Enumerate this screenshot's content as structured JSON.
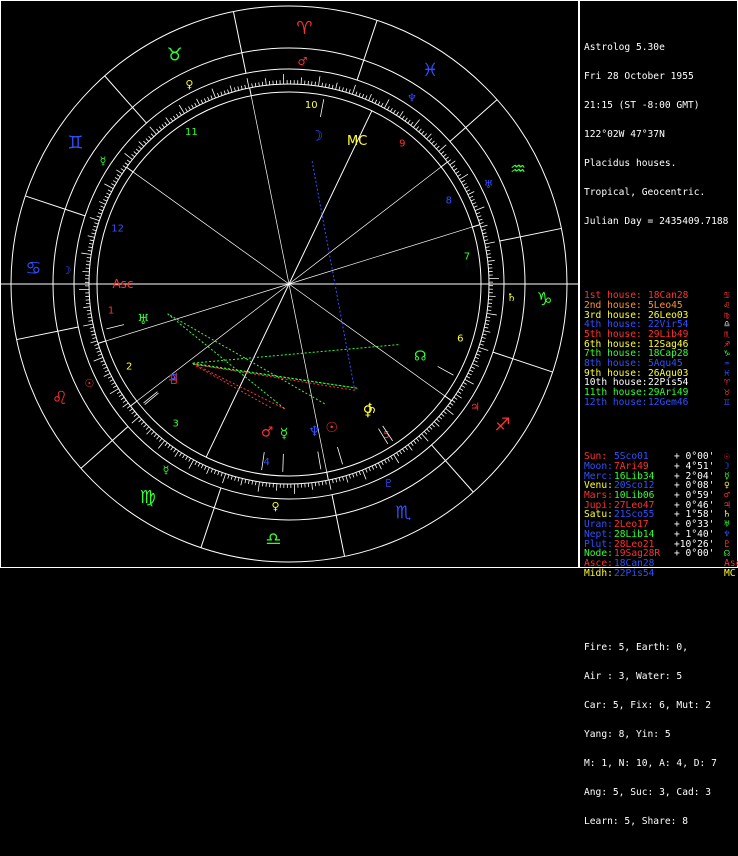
{
  "header": [
    "Astrolog 5.30e",
    "Fri 28 October 1955",
    "21:15 (ST -8:00 GMT)",
    "122°02W 47°37N",
    "Placidus houses.",
    "Tropical, Geocentric.",
    "Julian Day = 2435409.7188"
  ],
  "houses": [
    {
      "label": "1st house:",
      "pos": "18Can28",
      "glyph": "♋",
      "color": "#ff3030",
      "gcolor": "#ff3030"
    },
    {
      "label": "2nd house:",
      "pos": "5Leo45",
      "glyph": "♌",
      "color": "#ff9030",
      "gcolor": "#ff5020"
    },
    {
      "label": "3rd house:",
      "pos": "26Leo03",
      "glyph": "♍",
      "color": "#ffff30",
      "gcolor": "#ff3030"
    },
    {
      "label": "4th house:",
      "pos": "22Vir54",
      "glyph": "♎",
      "color": "#3050ff",
      "gcolor": "#ffffff"
    },
    {
      "label": "5th house:",
      "pos": "29Lib49",
      "glyph": "♏",
      "color": "#ff3030",
      "gcolor": "#ff3030"
    },
    {
      "label": "6th house:",
      "pos": "12Sag46",
      "glyph": "♐",
      "color": "#ffff30",
      "gcolor": "#ff3030"
    },
    {
      "label": "7th house:",
      "pos": "18Cap28",
      "glyph": "♑",
      "color": "#30ff30",
      "gcolor": "#30ff30"
    },
    {
      "label": "8th house:",
      "pos": "5Aqu45",
      "glyph": "♒",
      "color": "#3050ff",
      "gcolor": "#3050ff"
    },
    {
      "label": "9th house:",
      "pos": "26Aqu03",
      "glyph": "♓",
      "color": "#ffff30",
      "gcolor": "#3050ff"
    },
    {
      "label": "10th house:",
      "pos": "22Pis54",
      "glyph": "♈",
      "color": "#ffffff",
      "gcolor": "#ff3030"
    },
    {
      "label": "11th house:",
      "pos": "29Ari49",
      "glyph": "♉",
      "color": "#30ff30",
      "gcolor": "#ff3030"
    },
    {
      "label": "12th house:",
      "pos": "12Gem46",
      "glyph": "♊",
      "color": "#3050ff",
      "gcolor": "#3050ff"
    }
  ],
  "planets": [
    {
      "name": "Sun:",
      "pos": "5Sco01",
      "speed": "+ 0°00'",
      "glyph": "☉",
      "ncolor": "#ff3030",
      "pcolor": "#3050ff",
      "gcolor": "#ff3030"
    },
    {
      "name": "Moon:",
      "pos": "7Ari49",
      "speed": "+ 4°51'",
      "glyph": "☽",
      "ncolor": "#3050ff",
      "pcolor": "#ff3030",
      "gcolor": "#3050ff"
    },
    {
      "name": "Merc:",
      "pos": "16Lib34",
      "speed": "+ 2°04'",
      "glyph": "☿",
      "ncolor": "#3050ff",
      "pcolor": "#30ff30",
      "gcolor": "#30ff30"
    },
    {
      "name": "Venu:",
      "pos": "20Sco12",
      "speed": "+ 0°08'",
      "glyph": "♀",
      "ncolor": "#ffff30",
      "pcolor": "#3050ff",
      "gcolor": "#ffff30"
    },
    {
      "name": "Mars:",
      "pos": "10Lib06",
      "speed": "+ 0°59'",
      "glyph": "♂",
      "ncolor": "#ff3030",
      "pcolor": "#30ff30",
      "gcolor": "#ff3030"
    },
    {
      "name": "Jupi:",
      "pos": "27Leo47",
      "speed": "+ 0°46'",
      "glyph": "♃",
      "ncolor": "#ff3030",
      "pcolor": "#ff3030",
      "gcolor": "#ff3030"
    },
    {
      "name": "Satu:",
      "pos": "21Sco55",
      "speed": "+ 1°58'",
      "glyph": "♄",
      "ncolor": "#ffff30",
      "pcolor": "#3050ff",
      "gcolor": "#ffff30"
    },
    {
      "name": "Uran:",
      "pos": "2Leo17",
      "speed": "+ 0°33'",
      "glyph": "♅",
      "ncolor": "#3050ff",
      "pcolor": "#ff3030",
      "gcolor": "#30ff30"
    },
    {
      "name": "Nept:",
      "pos": "28Lib14",
      "speed": "+ 1°40'",
      "glyph": "♆",
      "ncolor": "#3050ff",
      "pcolor": "#30ff30",
      "gcolor": "#3050ff"
    },
    {
      "name": "Plut:",
      "pos": "28Leo21",
      "speed": "+10°26'",
      "glyph": "♇",
      "ncolor": "#3050ff",
      "pcolor": "#ff3030",
      "gcolor": "#ff3030"
    },
    {
      "name": "Node:",
      "pos": "19Sag28R",
      "speed": "+ 0°00'",
      "glyph": "☊",
      "ncolor": "#30ff30",
      "pcolor": "#ff3030",
      "gcolor": "#30ff30"
    },
    {
      "name": "Asce:",
      "pos": "18Can28",
      "speed": "",
      "glyph": "Asc",
      "ncolor": "#ff3030",
      "pcolor": "#3050ff",
      "gcolor": "#ff3030"
    },
    {
      "name": "Midh:",
      "pos": "22Pis54",
      "speed": "",
      "glyph": "MC",
      "ncolor": "#ffff30",
      "pcolor": "#3050ff",
      "gcolor": "#ffff30"
    }
  ],
  "stats": [
    "Fire: 5, Earth: 0,",
    "Air : 3, Water: 5",
    "Car: 5, Fix: 6, Mut: 2",
    "Yang: 8, Yin: 5",
    "M: 1, N: 10, A: 4, D: 7",
    "Ang: 5, Suc: 3, Cad: 3",
    "Learn: 5, Share: 8"
  ],
  "wheel": {
    "asc_deg": 108.47,
    "mc_deg": 352.9,
    "sign_glyphs": [
      "♈",
      "♉",
      "♊",
      "♋",
      "♌",
      "♍",
      "♎",
      "♏",
      "♐",
      "♑",
      "♒",
      "♓"
    ],
    "sign_colors": [
      "#ff3030",
      "#30ff30",
      "#3050ff",
      "#3050ff",
      "#ff3030",
      "#30ff30",
      "#30ff30",
      "#3050ff",
      "#ff3030",
      "#30ff30",
      "#30ff30",
      "#3050ff"
    ],
    "ruler_glyphs": [
      "♂",
      "♀",
      "☿",
      "☽",
      "☉",
      "☿",
      "♀",
      "♇",
      "♃",
      "♄",
      "♅",
      "♆"
    ],
    "ruler_colors": [
      "#ff3030",
      "#ffff30",
      "#30ff30",
      "#3050ff",
      "#ff3030",
      "#30ff30",
      "#ffff30",
      "#3050ff",
      "#ff3030",
      "#ffff30",
      "#3050ff",
      "#3050ff"
    ],
    "cusps": [
      108.47,
      125.75,
      146.05,
      172.9,
      209.82,
      252.77,
      288.47,
      305.75,
      326.05,
      352.9,
      29.82,
      72.77
    ],
    "house_numbers": [
      "1",
      "2",
      "3",
      "4",
      "5",
      "6",
      "7",
      "8",
      "9",
      "10",
      "11",
      "12"
    ],
    "house_number_colors": [
      "#ff3030",
      "#ffff30",
      "#30ff30",
      "#3050ff",
      "#ff3030",
      "#ffff30",
      "#30ff30",
      "#3050ff",
      "#ff3030",
      "#ffff30",
      "#30ff30",
      "#3050ff"
    ],
    "chart_planets": [
      {
        "lon": 215.02,
        "glyph": "☉",
        "color": "#ff3030",
        "ruler": "♂"
      },
      {
        "lon": 7.82,
        "glyph": "☽",
        "color": "#3050ff",
        "ruler": "♄"
      },
      {
        "lon": 196.57,
        "glyph": "☿",
        "color": "#30ff30",
        "ruler": "♆"
      },
      {
        "lon": 230.2,
        "glyph": "♀",
        "color": "#ffff30",
        "ruler": ""
      },
      {
        "lon": 190.1,
        "glyph": "♂",
        "color": "#ff3030",
        "ruler": "♃"
      },
      {
        "lon": 147.78,
        "glyph": "♃",
        "color": "#ff3030",
        "ruler": ""
      },
      {
        "lon": 231.92,
        "glyph": "♄",
        "color": "#ffff30",
        "ruler": "♂"
      },
      {
        "lon": 122.28,
        "glyph": "♅",
        "color": "#30ff30",
        "ruler": ""
      },
      {
        "lon": 208.23,
        "glyph": "♆",
        "color": "#3050ff",
        "ruler": ""
      },
      {
        "lon": 148.35,
        "glyph": "♇",
        "color": "#3050ff",
        "ruler": ""
      },
      {
        "lon": 259.47,
        "glyph": "☊",
        "color": "#30ff30",
        "ruler": ""
      }
    ]
  }
}
